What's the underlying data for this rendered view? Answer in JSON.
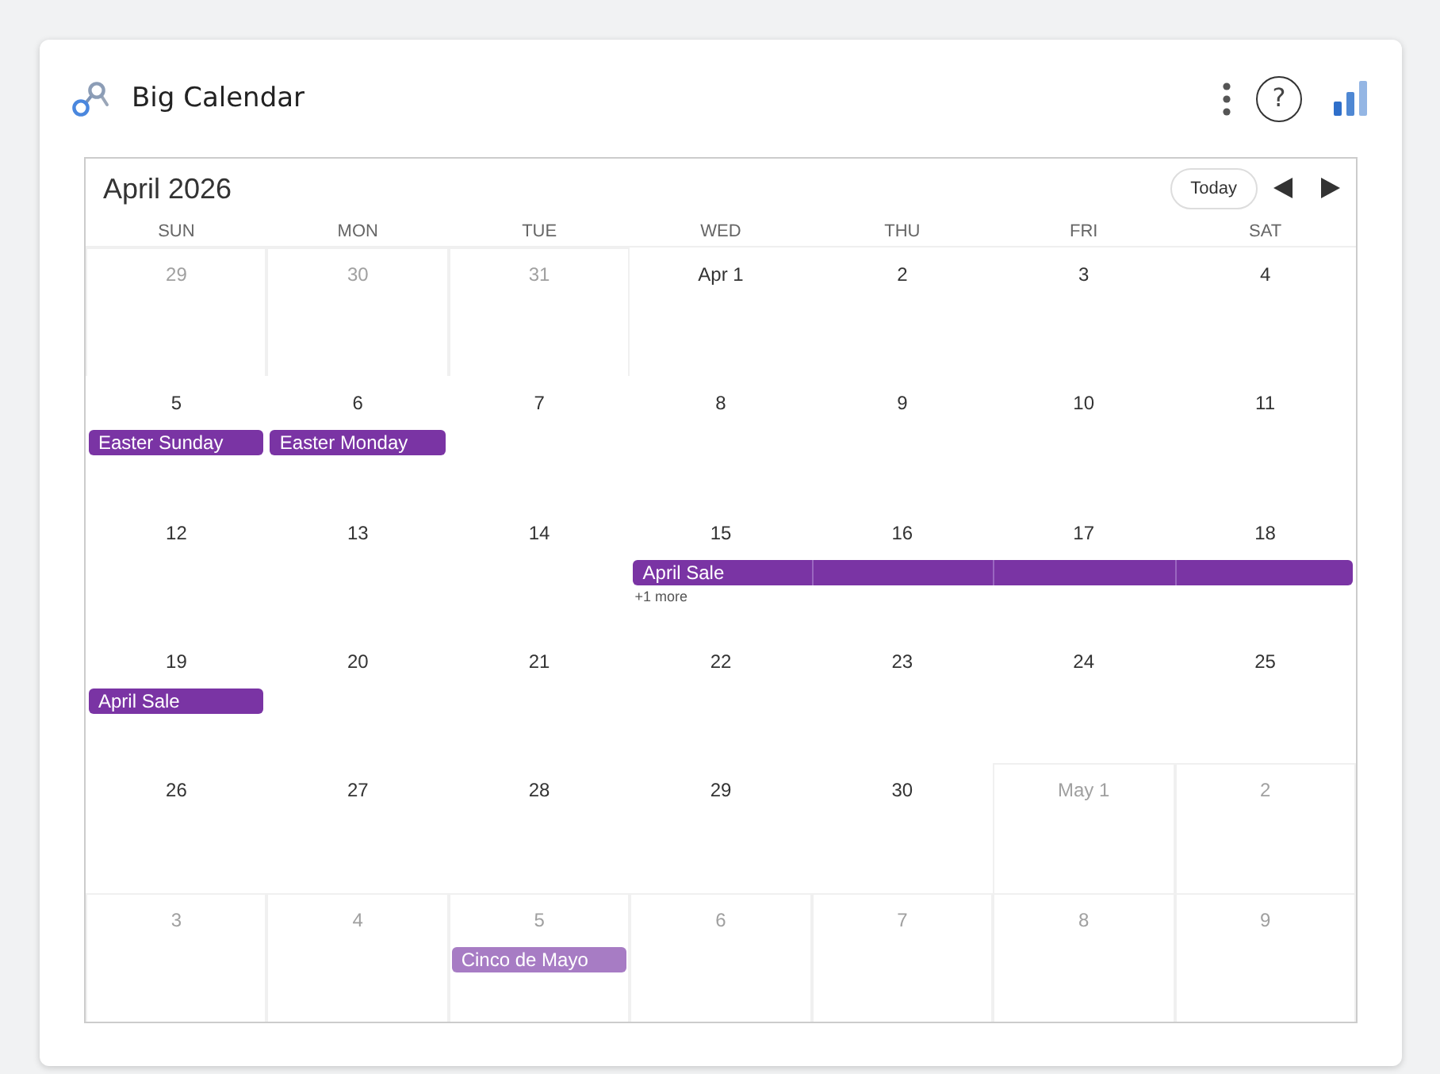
{
  "header": {
    "title": "Big Calendar",
    "help_button": "?"
  },
  "calendar": {
    "month_title": "April 2026",
    "today_button": "Today",
    "weekdays": [
      "SUN",
      "MON",
      "TUE",
      "WED",
      "THU",
      "FRI",
      "SAT"
    ],
    "weeks": [
      {
        "days": [
          {
            "date": "29",
            "in_month": false
          },
          {
            "date": "30",
            "in_month": false
          },
          {
            "date": "31",
            "in_month": false
          },
          {
            "date": "Apr 1",
            "in_month": true
          },
          {
            "date": "2",
            "in_month": true
          },
          {
            "date": "3",
            "in_month": true
          },
          {
            "date": "4",
            "in_month": true
          }
        ]
      },
      {
        "days": [
          {
            "date": "5",
            "in_month": true,
            "events": [
              {
                "kind": "single",
                "title": "Easter Sunday"
              }
            ]
          },
          {
            "date": "6",
            "in_month": true,
            "events": [
              {
                "kind": "single",
                "title": "Easter Monday"
              }
            ]
          },
          {
            "date": "7",
            "in_month": true
          },
          {
            "date": "8",
            "in_month": true
          },
          {
            "date": "9",
            "in_month": true
          },
          {
            "date": "10",
            "in_month": true
          },
          {
            "date": "11",
            "in_month": true
          }
        ]
      },
      {
        "days": [
          {
            "date": "12",
            "in_month": true
          },
          {
            "date": "13",
            "in_month": true
          },
          {
            "date": "14",
            "in_month": true
          },
          {
            "date": "15",
            "in_month": true,
            "events": [
              {
                "kind": "start",
                "title": "April Sale"
              }
            ],
            "more_link": "+1 more"
          },
          {
            "date": "16",
            "in_month": true,
            "events": [
              {
                "kind": "continued"
              }
            ]
          },
          {
            "date": "17",
            "in_month": true,
            "events": [
              {
                "kind": "continued"
              }
            ]
          },
          {
            "date": "18",
            "in_month": true,
            "events": [
              {
                "kind": "continued"
              }
            ]
          }
        ]
      },
      {
        "days": [
          {
            "date": "19",
            "in_month": true,
            "events": [
              {
                "kind": "single",
                "title": "April Sale"
              }
            ]
          },
          {
            "date": "20",
            "in_month": true
          },
          {
            "date": "21",
            "in_month": true
          },
          {
            "date": "22",
            "in_month": true
          },
          {
            "date": "23",
            "in_month": true
          },
          {
            "date": "24",
            "in_month": true
          },
          {
            "date": "25",
            "in_month": true
          }
        ]
      },
      {
        "days": [
          {
            "date": "26",
            "in_month": true
          },
          {
            "date": "27",
            "in_month": true
          },
          {
            "date": "28",
            "in_month": true
          },
          {
            "date": "29",
            "in_month": true
          },
          {
            "date": "30",
            "in_month": true
          },
          {
            "date": "May 1",
            "in_month": false
          },
          {
            "date": "2",
            "in_month": false
          }
        ]
      },
      {
        "days": [
          {
            "date": "3",
            "in_month": false
          },
          {
            "date": "4",
            "in_month": false
          },
          {
            "date": "5",
            "in_month": false,
            "events": [
              {
                "kind": "single",
                "title": "Cinco de Mayo"
              }
            ]
          },
          {
            "date": "6",
            "in_month": false
          },
          {
            "date": "7",
            "in_month": false
          },
          {
            "date": "8",
            "in_month": false
          },
          {
            "date": "9",
            "in_month": false
          }
        ]
      }
    ]
  }
}
